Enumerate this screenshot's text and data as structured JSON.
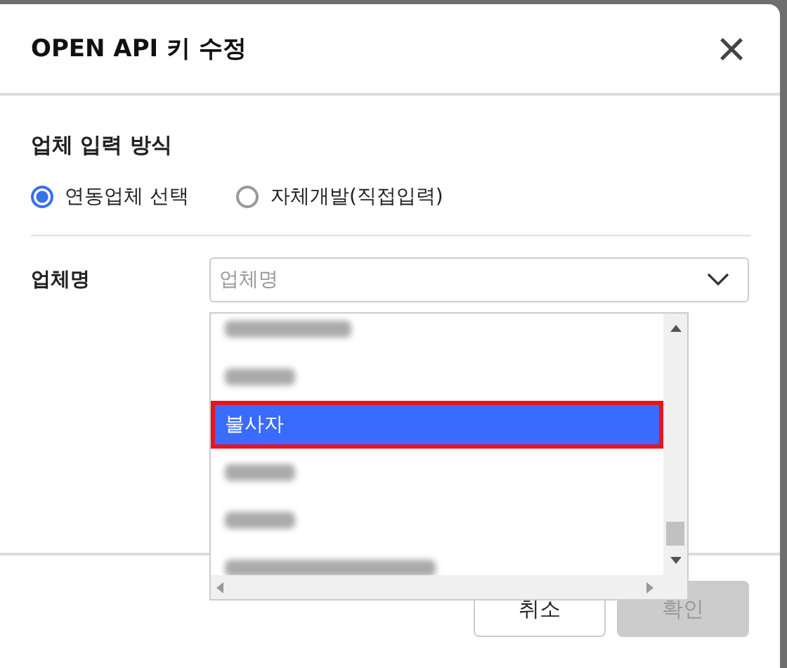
{
  "dialog": {
    "title": "OPEN API 키 수정",
    "close_icon": "×"
  },
  "input_method": {
    "heading": "업체 입력 방식",
    "options": [
      {
        "label": "연동업체 선택",
        "selected": true
      },
      {
        "label": "자체개발(직접입력)",
        "selected": false
      }
    ]
  },
  "company_field": {
    "label": "업체명",
    "placeholder": "업체명"
  },
  "dropdown_options": [
    {
      "kind": "blurred",
      "selected": false,
      "highlight": false
    },
    {
      "kind": "blurred",
      "selected": false,
      "highlight": false
    },
    {
      "kind": "text",
      "label": "불사자",
      "selected": true,
      "highlight": true
    },
    {
      "kind": "blurred",
      "selected": false,
      "highlight": false
    },
    {
      "kind": "blurred",
      "selected": false,
      "highlight": false
    },
    {
      "kind": "blurred",
      "selected": false,
      "highlight": false
    }
  ],
  "buttons": [
    {
      "label": "취소",
      "disabled": false
    },
    {
      "label": "확인",
      "disabled": true
    }
  ]
}
